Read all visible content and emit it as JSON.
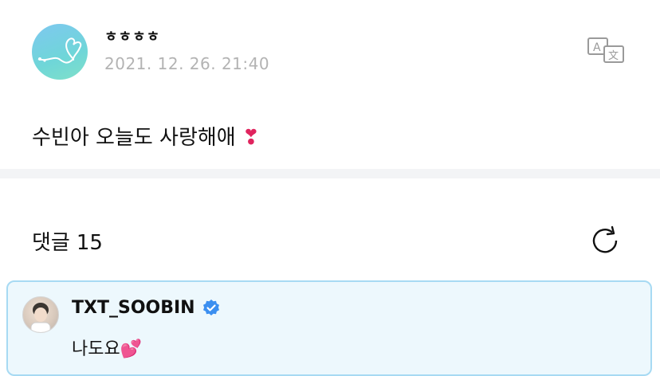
{
  "post": {
    "author": "ㅎㅎㅎㅎ",
    "timestamp": "2021. 12. 26. 21:40",
    "body": "수빈아 오늘도 사랑해애",
    "body_emoji": "❣",
    "translate_icon": "translate-icon"
  },
  "comments": {
    "title": "댓글",
    "count": "15",
    "refresh_icon": "refresh-icon",
    "items": [
      {
        "author": "TXT_SOOBIN",
        "verified": true,
        "text": "나도요",
        "emoji": "💕"
      }
    ]
  },
  "colors": {
    "timestamp": "#b3b3b3",
    "divider": "#f3f4f6",
    "highlight_bg": "#edf8fd",
    "highlight_border": "#a7daf3",
    "verified": "#3b8ff0"
  }
}
